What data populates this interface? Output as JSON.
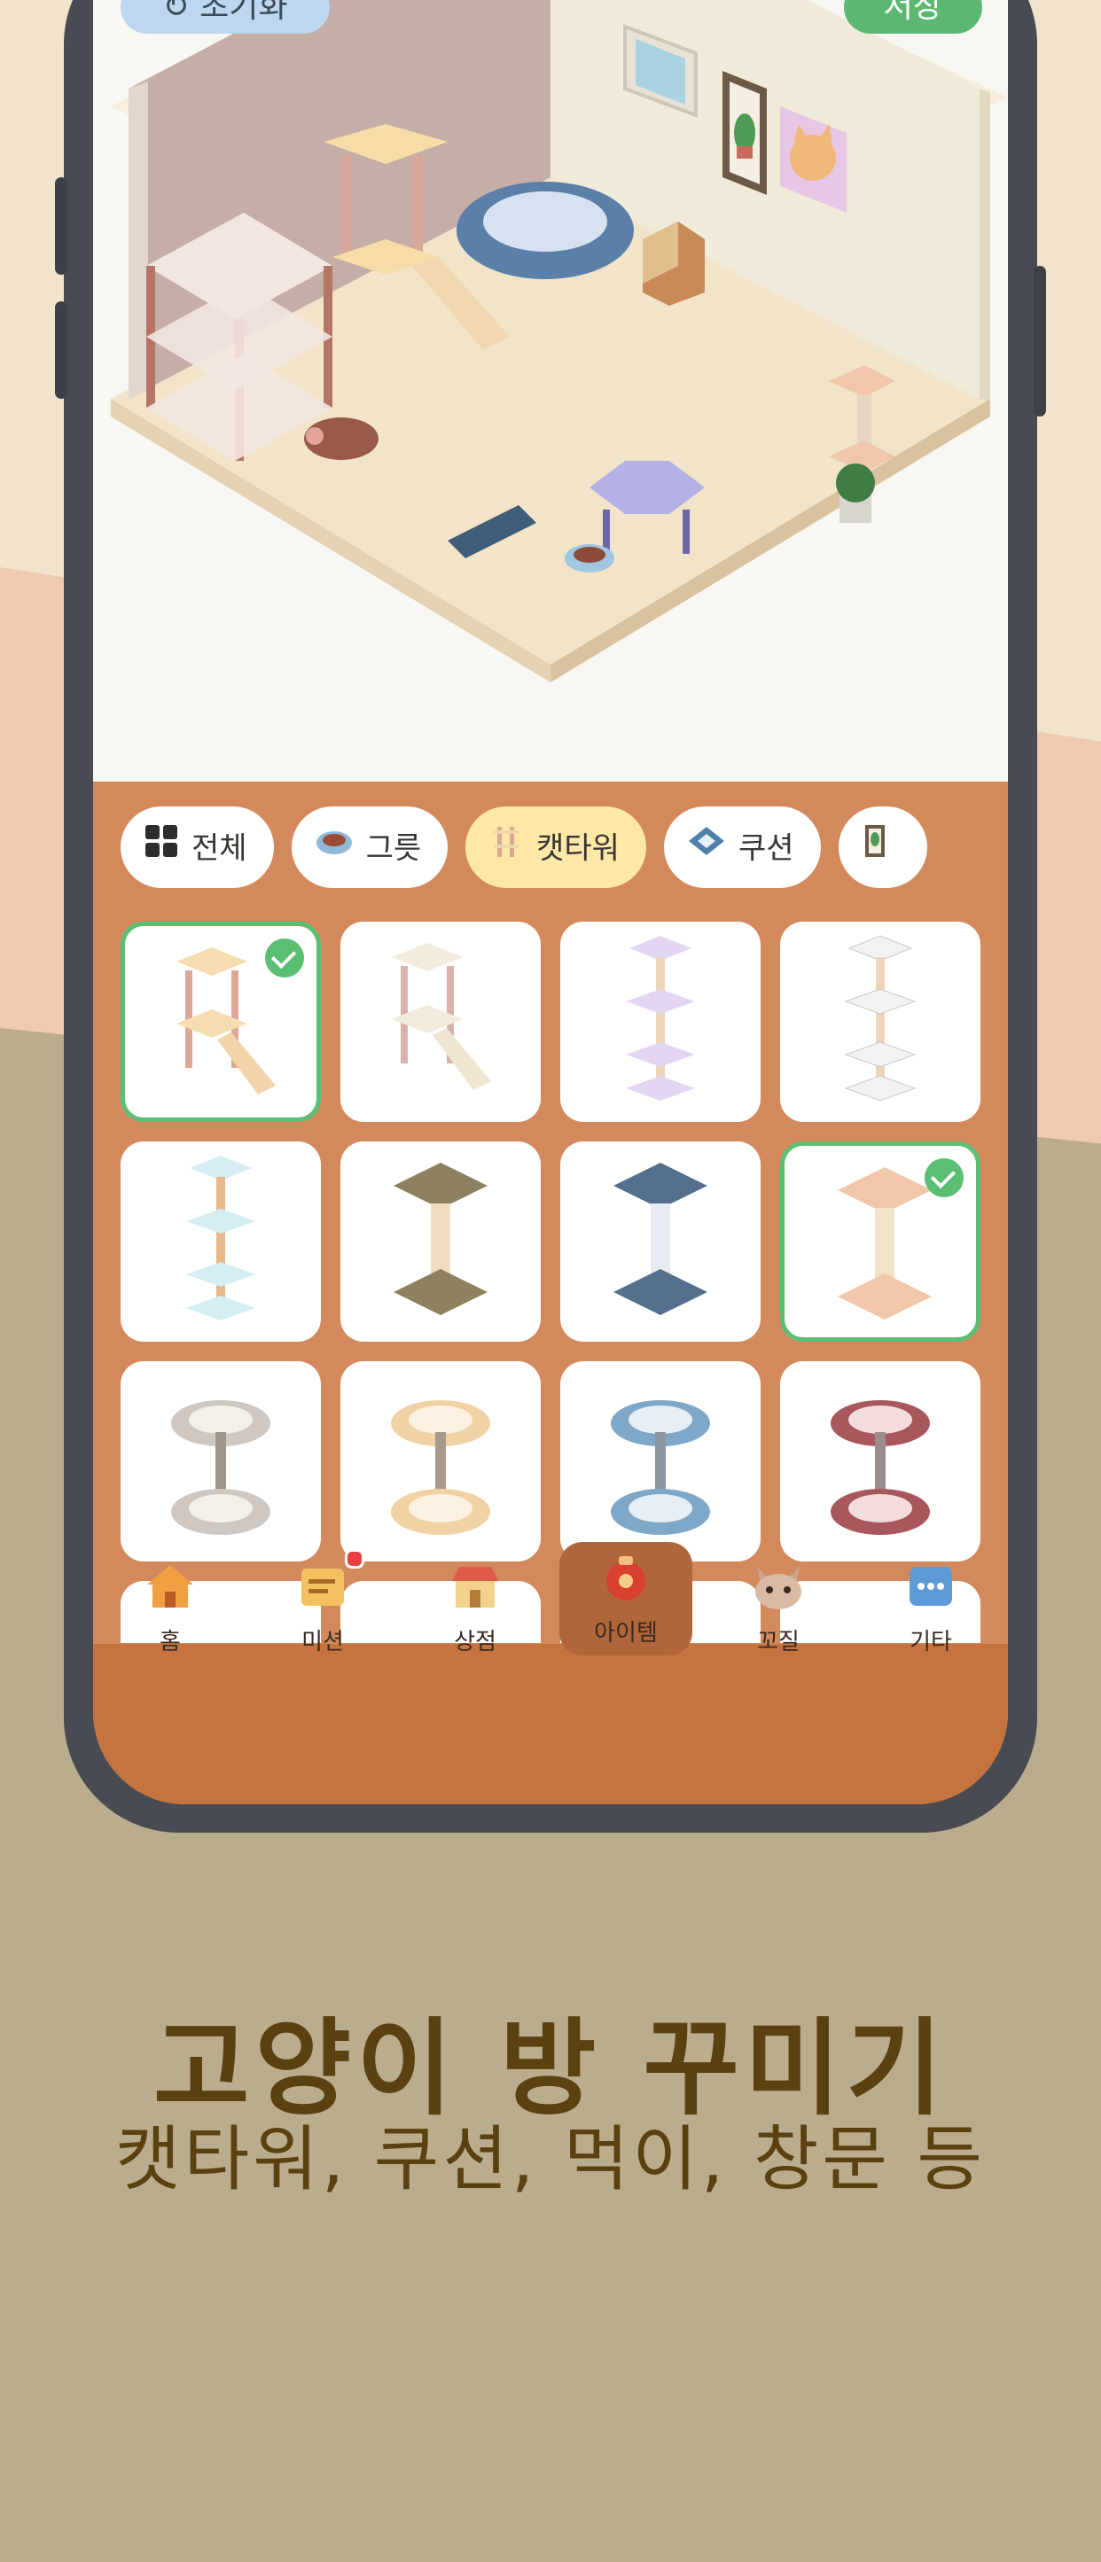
{
  "top_bar": {
    "reset_label": "↻ 초기화",
    "save_label": "저장"
  },
  "tabs": [
    {
      "label": "전체",
      "icon": "grid-icon",
      "active": false
    },
    {
      "label": "그릇",
      "icon": "bowl-icon",
      "active": false
    },
    {
      "label": "캣타워",
      "icon": "cat-tower-icon",
      "active": true
    },
    {
      "label": "쿠션",
      "icon": "cushion-icon",
      "active": false
    },
    {
      "label": "",
      "icon": "window-icon",
      "active": false
    }
  ],
  "items": [
    {
      "variant": "wood-stairs",
      "selected": true
    },
    {
      "variant": "white-stairs",
      "selected": false
    },
    {
      "variant": "lavender-tall",
      "selected": false
    },
    {
      "variant": "white-tall",
      "selected": false
    },
    {
      "variant": "mint-tall",
      "selected": false
    },
    {
      "variant": "olive-post",
      "selected": false
    },
    {
      "variant": "slate-post",
      "selected": false
    },
    {
      "variant": "peach-post",
      "selected": true
    },
    {
      "variant": "gray-round",
      "selected": false
    },
    {
      "variant": "cream-round",
      "selected": false
    },
    {
      "variant": "blue-round",
      "selected": false
    },
    {
      "variant": "burgundy-round",
      "selected": false
    }
  ],
  "nav": [
    {
      "label": "홈",
      "icon": "house-icon",
      "active": false
    },
    {
      "label": "미션",
      "icon": "mission-icon",
      "active": false,
      "badge": true
    },
    {
      "label": "상점",
      "icon": "shop-icon",
      "active": false
    },
    {
      "label": "아이템",
      "icon": "item-bag-icon",
      "active": true
    },
    {
      "label": "꼬질",
      "icon": "cat-face-icon",
      "active": false
    },
    {
      "label": "기타",
      "icon": "more-icon",
      "active": false
    }
  ],
  "promo": {
    "headline": "고양이 방 꾸미기",
    "subline": "캣타워, 쿠션, 먹이, 창문 등"
  },
  "colors": {
    "selection": "#5bbf73",
    "panel": "#d4895c",
    "navbar": "#c5743f",
    "headline": "#5b4010"
  }
}
